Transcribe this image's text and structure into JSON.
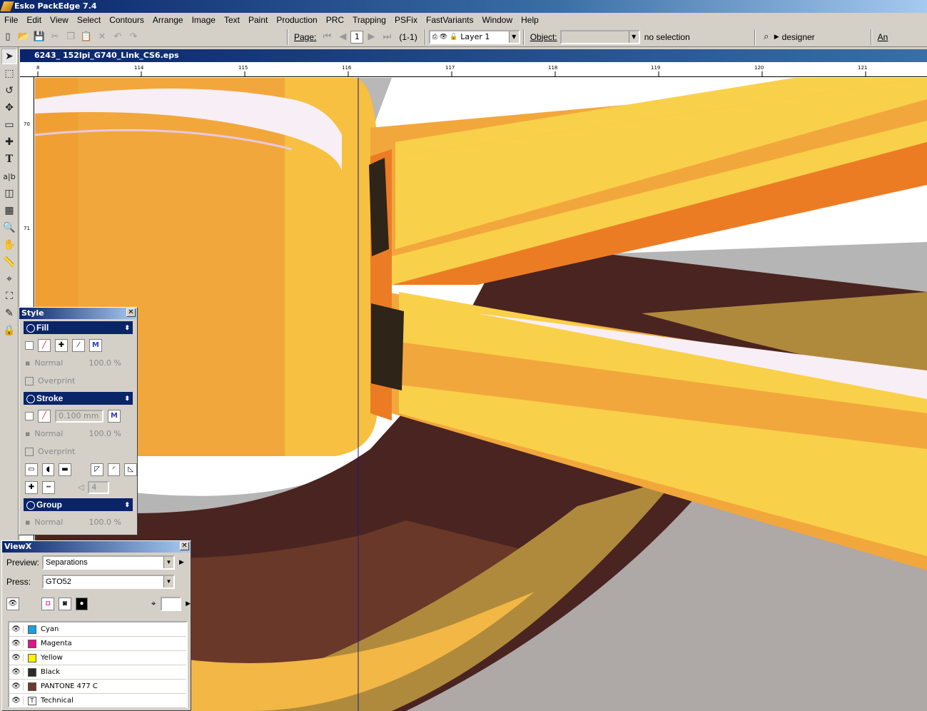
{
  "window": {
    "title": "Esko PackEdge 7.4"
  },
  "menu": [
    "File",
    "Edit",
    "View",
    "Select",
    "Contours",
    "Arrange",
    "Image",
    "Text",
    "Paint",
    "Production",
    "PRC",
    "Trapping",
    "PSFix",
    "FastVariants",
    "Window",
    "Help"
  ],
  "toolbar": {
    "page_label": "Page:",
    "page_value": "1",
    "page_range": "(1-1)",
    "layer_value": "Layer 1",
    "object_label": "Object:",
    "selection_text": "no selection",
    "workspace": "designer",
    "overflow": "An"
  },
  "document": {
    "title": "6243_ 152lpi_G740_Link_CS6.eps",
    "ruler_h": [
      "8",
      "114",
      "115",
      "116",
      "117",
      "118",
      "119",
      "120",
      "121"
    ],
    "ruler_v": [
      "70",
      "71"
    ]
  },
  "style_panel": {
    "title": "Style",
    "fill": "Fill",
    "stroke": "Stroke",
    "group": "Group",
    "blend": "Normal",
    "opacity": "100.0 %",
    "overprint": "Overprint",
    "stroke_width": "0.100 mm",
    "miter": "4"
  },
  "viewx_panel": {
    "title": "ViewX",
    "preview_label": "Preview:",
    "preview_value": "Separations",
    "press_label": "Press:",
    "press_value": "GTO52",
    "separations": [
      {
        "name": "Cyan",
        "color": "#1aa0e0"
      },
      {
        "name": "Magenta",
        "color": "#e0148c"
      },
      {
        "name": "Yellow",
        "color": "#fff200"
      },
      {
        "name": "Black",
        "color": "#2a2a2a"
      },
      {
        "name": "PANTONE 477 C",
        "color": "#6b3a2a"
      },
      {
        "name": "Technical",
        "color": "#ffffff"
      }
    ]
  },
  "colors": {
    "accent": "#0a246a",
    "chrome": "#d4d0c8"
  }
}
